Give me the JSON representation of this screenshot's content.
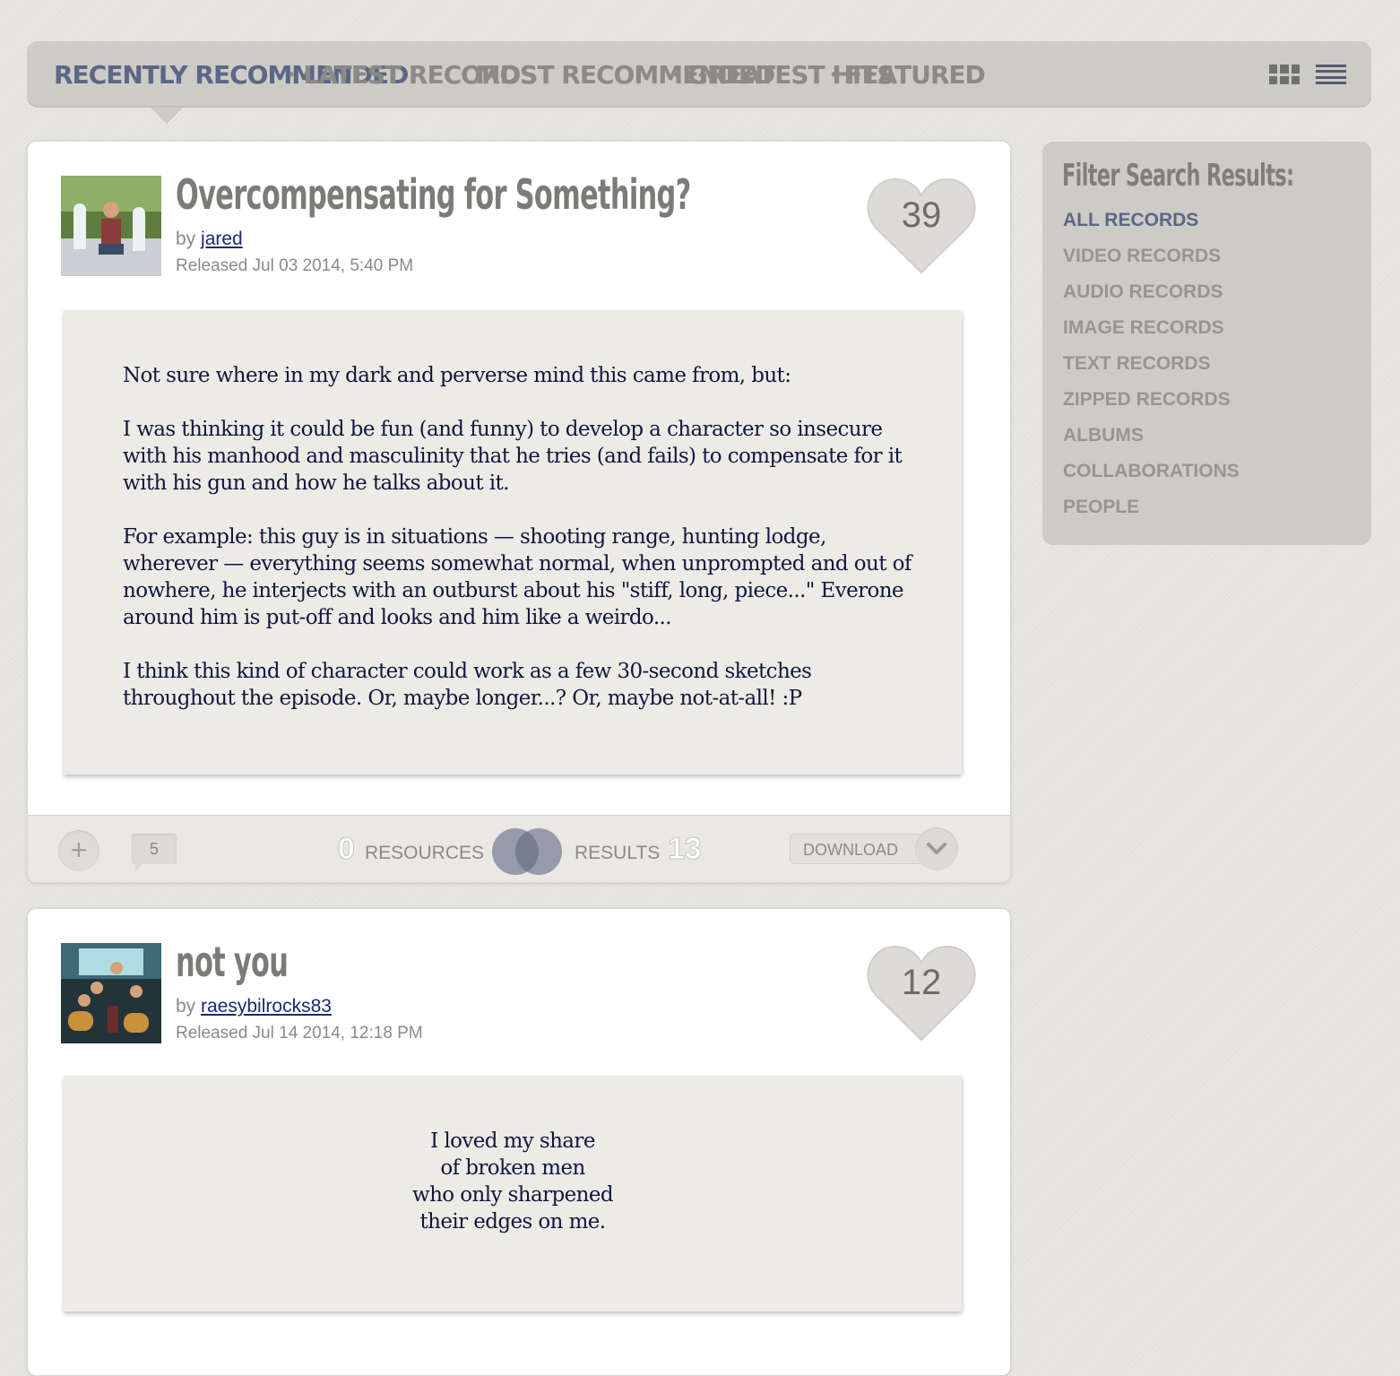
{
  "nav": {
    "tabs": [
      {
        "label": "RECENTLY RECOMMENDED",
        "active": true
      },
      {
        "label": "LATEST RECORDS",
        "active": false
      },
      {
        "label": "MOST RECOMMENDED",
        "active": false
      },
      {
        "label": "GREATEST HITS",
        "active": false
      },
      {
        "label": "FEATURED",
        "active": false
      }
    ],
    "separator": "•"
  },
  "records": [
    {
      "title": "Overcompensating for Something?",
      "by_label": "by",
      "author": "jared",
      "released": "Released Jul 03 2014, 5:40 PM",
      "hearts": "39",
      "paragraphs": [
        "Not sure where in my dark and perverse mind this came from, but:",
        "I was thinking it could be fun (and funny) to develop a character so insecure with his manhood and masculinity that he tries (and fails) to compensate for it with his gun and how he talks about it.",
        "For example:  this guy is in situations — shooting range, hunting lodge, wherever — everything seems somewhat normal, when unprompted and out of nowhere, he interjects with an outburst about his \"stiff, long, piece...\" Everone around him is put-off and looks and him like a weirdo...",
        "I think this kind of character could work as a few 30-second sketches throughout the episode.  Or, maybe longer...?  Or, maybe not-at-all! :P"
      ],
      "footer": {
        "plus": "+",
        "comments": "5",
        "resources_count": "0",
        "resources_label": "RESOURCES",
        "results_label": "RESULTS",
        "results_count": "13",
        "download_label": "DOWNLOAD"
      }
    },
    {
      "title": "not you",
      "by_label": "by",
      "author": "raesybilrocks83",
      "released": "Released Jul 14 2014, 12:18 PM",
      "hearts": "12",
      "poem_lines": [
        "I loved my share",
        "of broken men",
        "who only sharpened",
        "their edges on me."
      ]
    }
  ],
  "sidebar": {
    "heading": "Filter Search Results:",
    "items": [
      {
        "label": "ALL RECORDS",
        "active": true
      },
      {
        "label": "VIDEO RECORDS",
        "active": false
      },
      {
        "label": "AUDIO RECORDS",
        "active": false
      },
      {
        "label": "IMAGE RECORDS",
        "active": false
      },
      {
        "label": "TEXT RECORDS",
        "active": false
      },
      {
        "label": "ZIPPED RECORDS",
        "active": false
      },
      {
        "label": "ALBUMS",
        "active": false
      },
      {
        "label": "COLLABORATIONS",
        "active": false
      },
      {
        "label": "PEOPLE",
        "active": false
      }
    ]
  },
  "colors": {
    "accent": "#5b6786",
    "muted": "#8b8a86",
    "ink": "#12163e"
  }
}
